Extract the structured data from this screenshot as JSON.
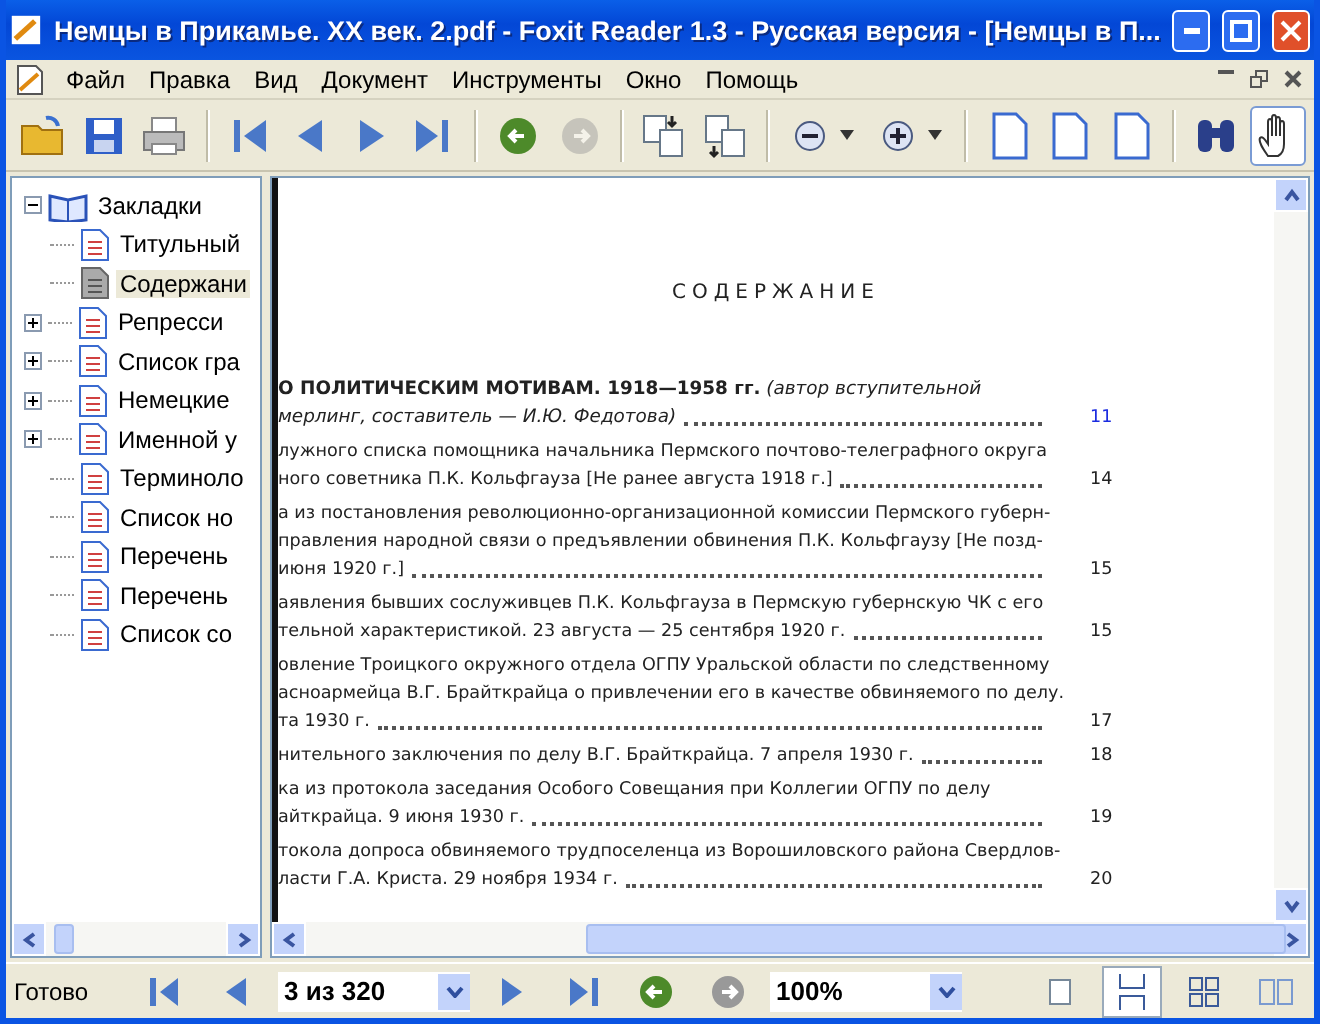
{
  "window": {
    "title": "Немцы в Прикамье. XX век. 2.pdf - Foxit Reader 1.3 - Русская версия  - [Немцы в П..."
  },
  "menu": [
    "Файл",
    "Правка",
    "Вид",
    "Документ",
    "Инструменты",
    "Окно",
    "Помощь"
  ],
  "toolbar": [
    {
      "kind": "open",
      "disabled": false
    },
    {
      "kind": "save",
      "disabled": false
    },
    {
      "kind": "print",
      "disabled": false
    },
    {
      "kind": "sep"
    },
    {
      "kind": "first",
      "disabled": false
    },
    {
      "kind": "prev",
      "disabled": false
    },
    {
      "kind": "next",
      "disabled": false
    },
    {
      "kind": "last",
      "disabled": false
    },
    {
      "kind": "sep"
    },
    {
      "kind": "back",
      "disabled": false
    },
    {
      "kind": "forward",
      "disabled": true
    },
    {
      "kind": "sep"
    },
    {
      "kind": "rotate-right",
      "disabled": false
    },
    {
      "kind": "rotate-left",
      "disabled": false
    },
    {
      "kind": "sep"
    },
    {
      "kind": "zoom-out",
      "disabled": false
    },
    {
      "kind": "zoom-in",
      "disabled": false
    },
    {
      "kind": "sep"
    },
    {
      "kind": "page",
      "disabled": false
    },
    {
      "kind": "page",
      "disabled": false
    },
    {
      "kind": "page",
      "disabled": false
    },
    {
      "kind": "sep"
    },
    {
      "kind": "find",
      "disabled": false
    },
    {
      "kind": "hand",
      "disabled": false,
      "selected": true
    }
  ],
  "bookmarks": {
    "label": "Закладки",
    "expanded": true,
    "children": [
      {
        "label": "Титульный",
        "selected": false,
        "expandable": false
      },
      {
        "label": "Содержани",
        "selected": true,
        "expandable": false
      },
      {
        "label": "Репресси",
        "selected": false,
        "expandable": true
      },
      {
        "label": "Список гра",
        "selected": false,
        "expandable": true
      },
      {
        "label": "Немецкие",
        "selected": false,
        "expandable": true
      },
      {
        "label": "Именной у",
        "selected": false,
        "expandable": true
      },
      {
        "label": "Терминоло",
        "selected": false,
        "expandable": false
      },
      {
        "label": "Список но",
        "selected": false,
        "expandable": false
      },
      {
        "label": "Перечень",
        "selected": false,
        "expandable": false
      },
      {
        "label": "Перечень",
        "selected": false,
        "expandable": false
      },
      {
        "label": "Список со",
        "selected": false,
        "expandable": false
      }
    ]
  },
  "document": {
    "heading": "СОДЕРЖАНИЕ",
    "entries": [
      {
        "kind": "section",
        "link": true,
        "lines": [
          "**О ПОЛИТИЧЕСКИМ МОТИВАМ. 1918—1958 гг.** *(автор вступительной*",
          "мерлинг, составитель — И.Ю. Федотова)"
        ],
        "page": "11"
      },
      {
        "kind": "item",
        "link": false,
        "lines": [
          "лужного списка помощника начальника Пермского почтово-телеграфного округа",
          "ного советника П.К. Кольфгауза [Не ранее августа 1918 г.]"
        ],
        "page": "14"
      },
      {
        "kind": "item",
        "link": false,
        "lines": [
          "а из постановления революционно-организационной комиссии Пермского губерн-",
          "правления народной связи о предъявлении обвинения П.К. Кольфгаузу [Не позд-",
          "июня 1920 г.]"
        ],
        "page": "15"
      },
      {
        "kind": "item",
        "link": false,
        "lines": [
          "аявления бывших сослуживцев П.К. Кольфгауза в Пермскую губернскую ЧК с его",
          "тельной характеристикой. 23 августа — 25 сентября 1920 г."
        ],
        "page": "15"
      },
      {
        "kind": "item",
        "link": false,
        "lines": [
          "овление Троицкого окружного отдела ОГПУ Уральской области по следственному",
          "асноармейца В.Г. Брайткрайца о привлечении его в качестве обвиняемого по делу.",
          "та 1930 г."
        ],
        "page": "17"
      },
      {
        "kind": "item",
        "link": false,
        "lines": [
          "нительного заключения по делу В.Г. Брайткрайца. 7 апреля 1930 г."
        ],
        "page": "18"
      },
      {
        "kind": "item",
        "link": false,
        "lines": [
          "ка из протокола заседания Особого Совещания при Коллегии ОГПУ по делу",
          "айткрайца. 9 июня 1930 г."
        ],
        "page": "19"
      },
      {
        "kind": "item",
        "link": false,
        "lines": [
          "токола допроса обвиняемого трудпоселенца из Ворошиловского района Свердлов-",
          "ласти Г.А. Криста. 29 ноября 1934 г."
        ],
        "page": "20"
      }
    ]
  },
  "status_bar": {
    "status": "Готово",
    "page_field": "3 из 320",
    "zoom_field": "100%",
    "view_modes": [
      {
        "kind": "single",
        "selected": false
      },
      {
        "kind": "continuous",
        "selected": true
      },
      {
        "kind": "facing-continuous",
        "selected": false
      },
      {
        "kind": "facing",
        "selected": false
      }
    ]
  }
}
